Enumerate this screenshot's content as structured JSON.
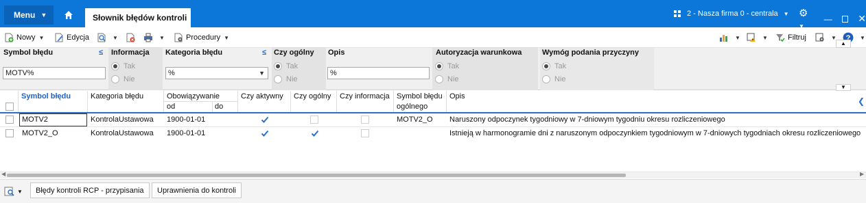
{
  "titlebar": {
    "menu_label": "Menu",
    "active_tab": "Słownik błędów kontroli",
    "company": "2 - Nasza firma 0 - centrala",
    "colors": {
      "bar": "#0c77d8",
      "menu": "#0a63b8"
    }
  },
  "toolbar": {
    "new_label": "Nowy",
    "edit_label": "Edycja",
    "procedures_label": "Procedury",
    "filter_label": "Filtruj"
  },
  "filter": {
    "symbol_label": "Symbol błędu",
    "symbol_value": "MOTV%",
    "info_label": "Informacja",
    "category_label": "Kategoria błędu",
    "category_value": "%",
    "general_label": "Czy ogólny",
    "desc_label": "Opis",
    "desc_value": "%",
    "auth_label": "Autoryzacja warunkowa",
    "reason_label": "Wymóg podania przyczyny",
    "yes": "Tak",
    "no": "Nie"
  },
  "grid": {
    "headers": {
      "symbol": "Symbol błędu",
      "category": "Kategoria błędu",
      "validity": "Obowiązywanie",
      "from": "od",
      "to": "do",
      "active": "Czy aktywny",
      "general": "Czy ogólny",
      "info": "Czy informacja",
      "general_symbol_1": "Symbol błędu",
      "general_symbol_2": "ogólnego",
      "desc": "Opis"
    },
    "rows": [
      {
        "symbol": "MOTV2",
        "category": "KontrolaUstawowa",
        "from": "1900-01-01",
        "to": "",
        "active": true,
        "general": false,
        "info": false,
        "general_symbol": "MOTV2_O",
        "desc": "Naruszony odpoczynek tygodniowy w 7-dniowym tygodniu okresu rozliczeniowego"
      },
      {
        "symbol": "MOTV2_O",
        "category": "KontrolaUstawowa",
        "from": "1900-01-01",
        "to": "",
        "active": true,
        "general": true,
        "info": false,
        "general_symbol": "",
        "desc": "Istnieją w harmonogramie dni z naruszonym odpoczynkiem tygodniowym w 7-dniowych tygodniach okresu rozliczeniowego"
      }
    ]
  },
  "bottom": {
    "tab1": "Błędy kontroli RCP - przypisania",
    "tab2": "Uprawnienia do kontroli"
  },
  "icons": [
    "home-icon",
    "chevron-down-icon",
    "grid-icon",
    "gear-icon",
    "minimize-icon",
    "maximize-icon",
    "close-icon",
    "new-icon",
    "edit-icon",
    "preview-icon",
    "delete-icon",
    "print-icon",
    "procedures-icon",
    "chart-icon",
    "warning-icon",
    "filter-icon",
    "settings-icon",
    "help-icon",
    "sort-icon",
    "search-icon"
  ]
}
